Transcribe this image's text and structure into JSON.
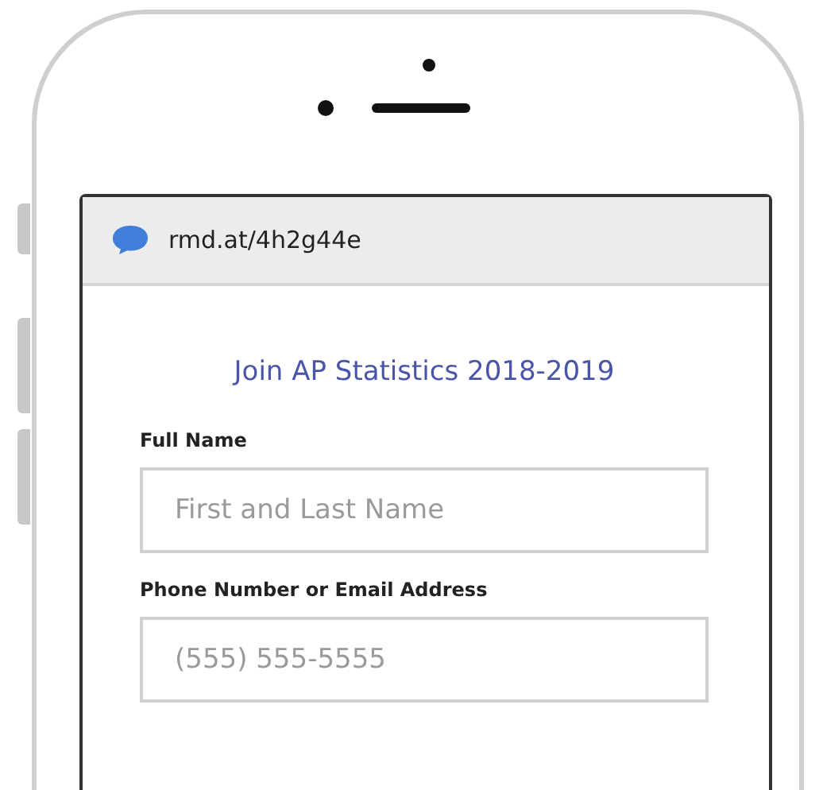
{
  "address_bar": {
    "url": "rmd.at/4h2g44e"
  },
  "form": {
    "title": "Join AP Statistics 2018-2019",
    "fields": [
      {
        "label": "Full Name",
        "placeholder": "First and Last Name"
      },
      {
        "label": "Phone Number or Email Address",
        "placeholder": "(555) 555-5555"
      }
    ]
  }
}
